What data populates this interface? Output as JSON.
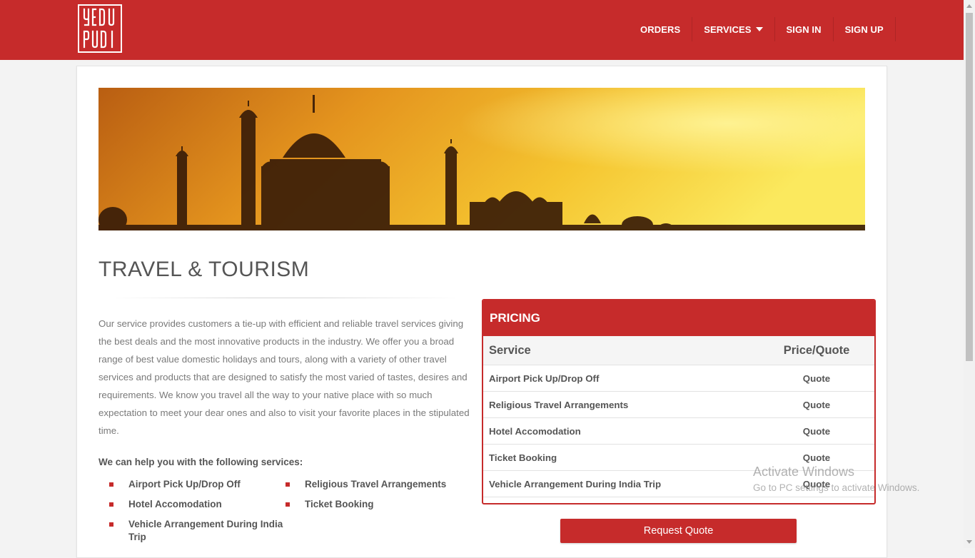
{
  "brand": {
    "logo_text": "YEDUPUDI",
    "colors": {
      "primary": "#c62b2b",
      "text": "#555555",
      "muted": "#7a7a7a"
    }
  },
  "nav": {
    "items": [
      {
        "label": "ORDERS"
      },
      {
        "label": "SERVICES",
        "icon": "caret-down-icon"
      },
      {
        "label": "SIGN IN"
      },
      {
        "label": "SIGN UP"
      }
    ]
  },
  "banner": {
    "description_icon": "taj-mahal-sunset-banner"
  },
  "page": {
    "title": "TRAVEL & TOURISM",
    "description": "Our service provides customers a tie-up with efficient and reliable travel services giving the best deals and the most innovative products in the industry. We offer you a broad range of best value domestic holidays and tours, along with a variety of other travel services and products that are designed to satisfy the most varied of tastes, desires and requirements. We know you travel all the way to your native place with so much expectation to meet your dear ones and also to visit your favorite places in the stipulated time.",
    "services_heading": "We can help you with the following services:",
    "services": [
      "Airport Pick Up/Drop Off",
      "Religious Travel Arrangements",
      "Hotel Accomodation",
      "Ticket Booking",
      "Vehicle Arrangement During India Trip"
    ]
  },
  "pricing": {
    "title": "PRICING",
    "col_service": "Service",
    "col_price": "Price/Quote",
    "rows": [
      {
        "service": "Airport Pick Up/Drop Off",
        "price": "Quote"
      },
      {
        "service": "Religious Travel Arrangements",
        "price": "Quote"
      },
      {
        "service": "Hotel Accomodation",
        "price": "Quote"
      },
      {
        "service": "Ticket Booking",
        "price": "Quote"
      },
      {
        "service": "Vehicle Arrangement During India Trip",
        "price": "Quote"
      }
    ]
  },
  "request_button": "Request Quote",
  "watermark": {
    "title": "Activate Windows",
    "subtitle": "Go to PC settings to activate Windows."
  }
}
